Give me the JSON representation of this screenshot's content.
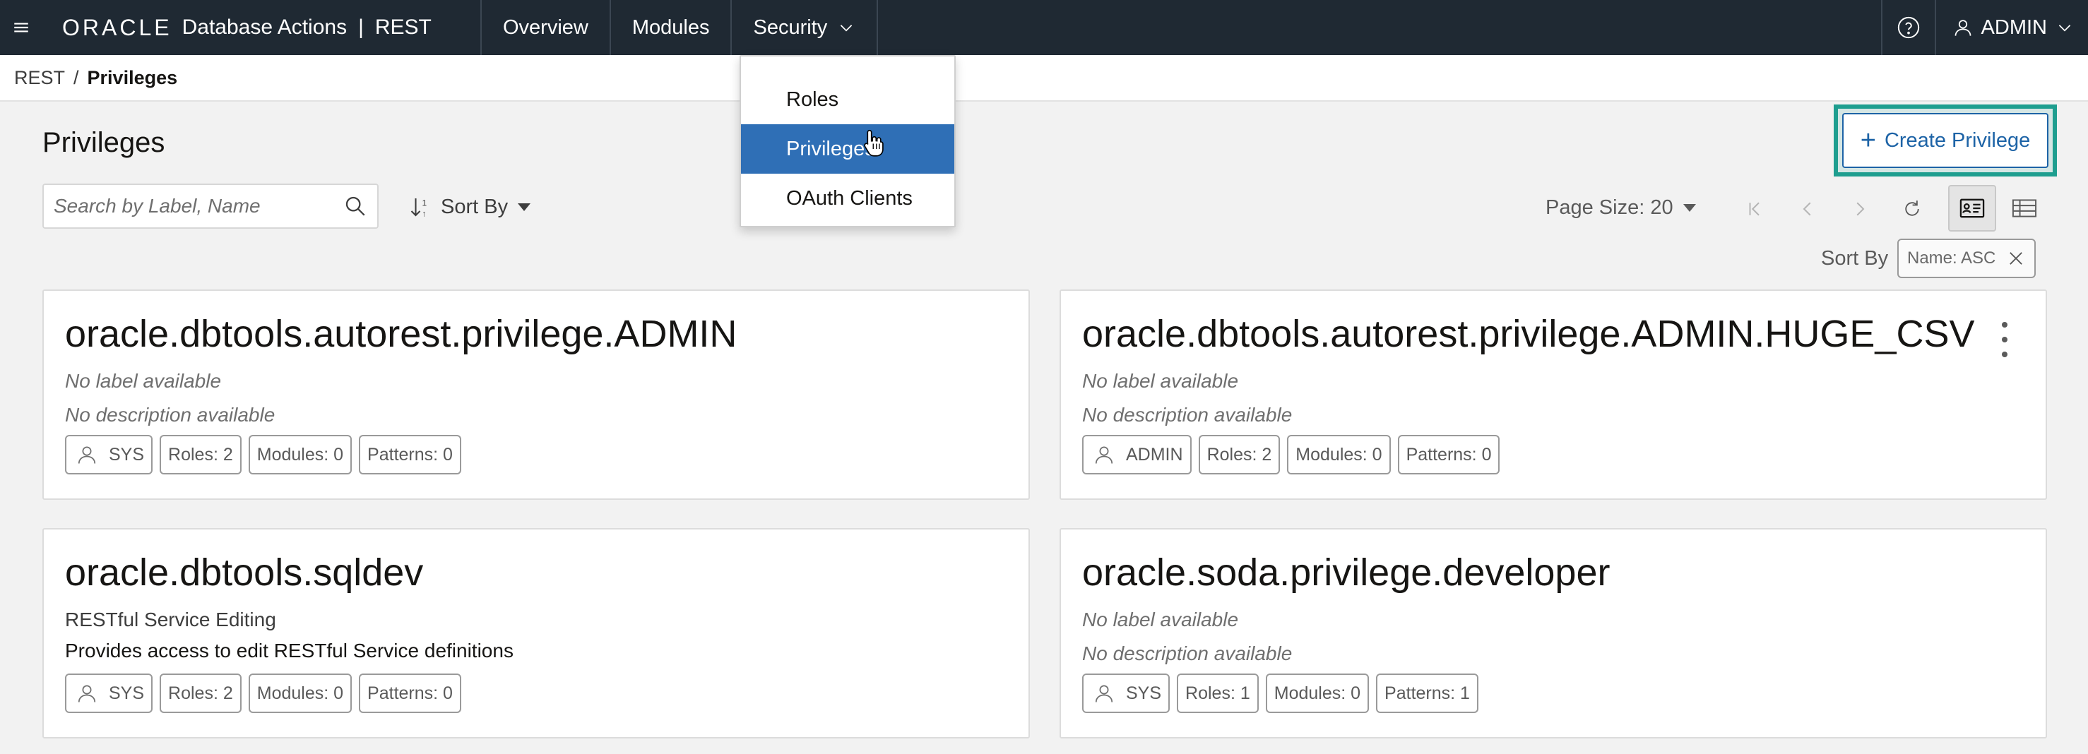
{
  "header": {
    "brand": "ORACLE",
    "app_name": "Database Actions",
    "separator": "|",
    "section": "REST",
    "nav": [
      {
        "label": "Overview"
      },
      {
        "label": "Modules"
      },
      {
        "label": "Security"
      }
    ],
    "user": "ADMIN",
    "icons": {
      "menu": "hamburger-icon",
      "help": "question-circle-icon",
      "user": "person-icon"
    }
  },
  "breadcrumb": {
    "parent": "REST",
    "separator": "/",
    "current": "Privileges"
  },
  "page": {
    "title": "Privileges",
    "create_button": "Create Privilege",
    "highlight_color": "#1e9e8f"
  },
  "toolbar": {
    "search_placeholder": "Search by Label, Name",
    "sort_by": "Sort By",
    "page_size": "Page Size: 20",
    "sort_label": "Sort By",
    "sort_value": "Name: ASC"
  },
  "security_menu": {
    "items": [
      {
        "label": "Roles"
      },
      {
        "label": "Privileges"
      },
      {
        "label": "OAuth Clients"
      }
    ],
    "active_index": 1,
    "active_color": "#2f6fb6"
  },
  "cards": [
    {
      "name": "oracle.dbtools.autorest.privilege.ADMIN",
      "label": "No label available",
      "description": "No description available",
      "owner": "SYS",
      "roles": "Roles: 2",
      "modules": "Modules: 0",
      "patterns": "Patterns: 0"
    },
    {
      "name": "oracle.dbtools.autorest.privilege.ADMIN.HUGE_CSV",
      "label": "No label available",
      "description": "No description available",
      "owner": "ADMIN",
      "roles": "Roles: 2",
      "modules": "Modules: 0",
      "patterns": "Patterns: 0"
    },
    {
      "name": "oracle.dbtools.sqldev",
      "label": "RESTful Service Editing",
      "description": "Provides access to edit RESTful Service definitions",
      "owner": "SYS",
      "roles": "Roles: 2",
      "modules": "Modules: 0",
      "patterns": "Patterns: 0"
    },
    {
      "name": "oracle.soda.privilege.developer",
      "label": "No label available",
      "description": "No description available",
      "owner": "SYS",
      "roles": "Roles: 1",
      "modules": "Modules: 0",
      "patterns": "Patterns: 1"
    }
  ]
}
